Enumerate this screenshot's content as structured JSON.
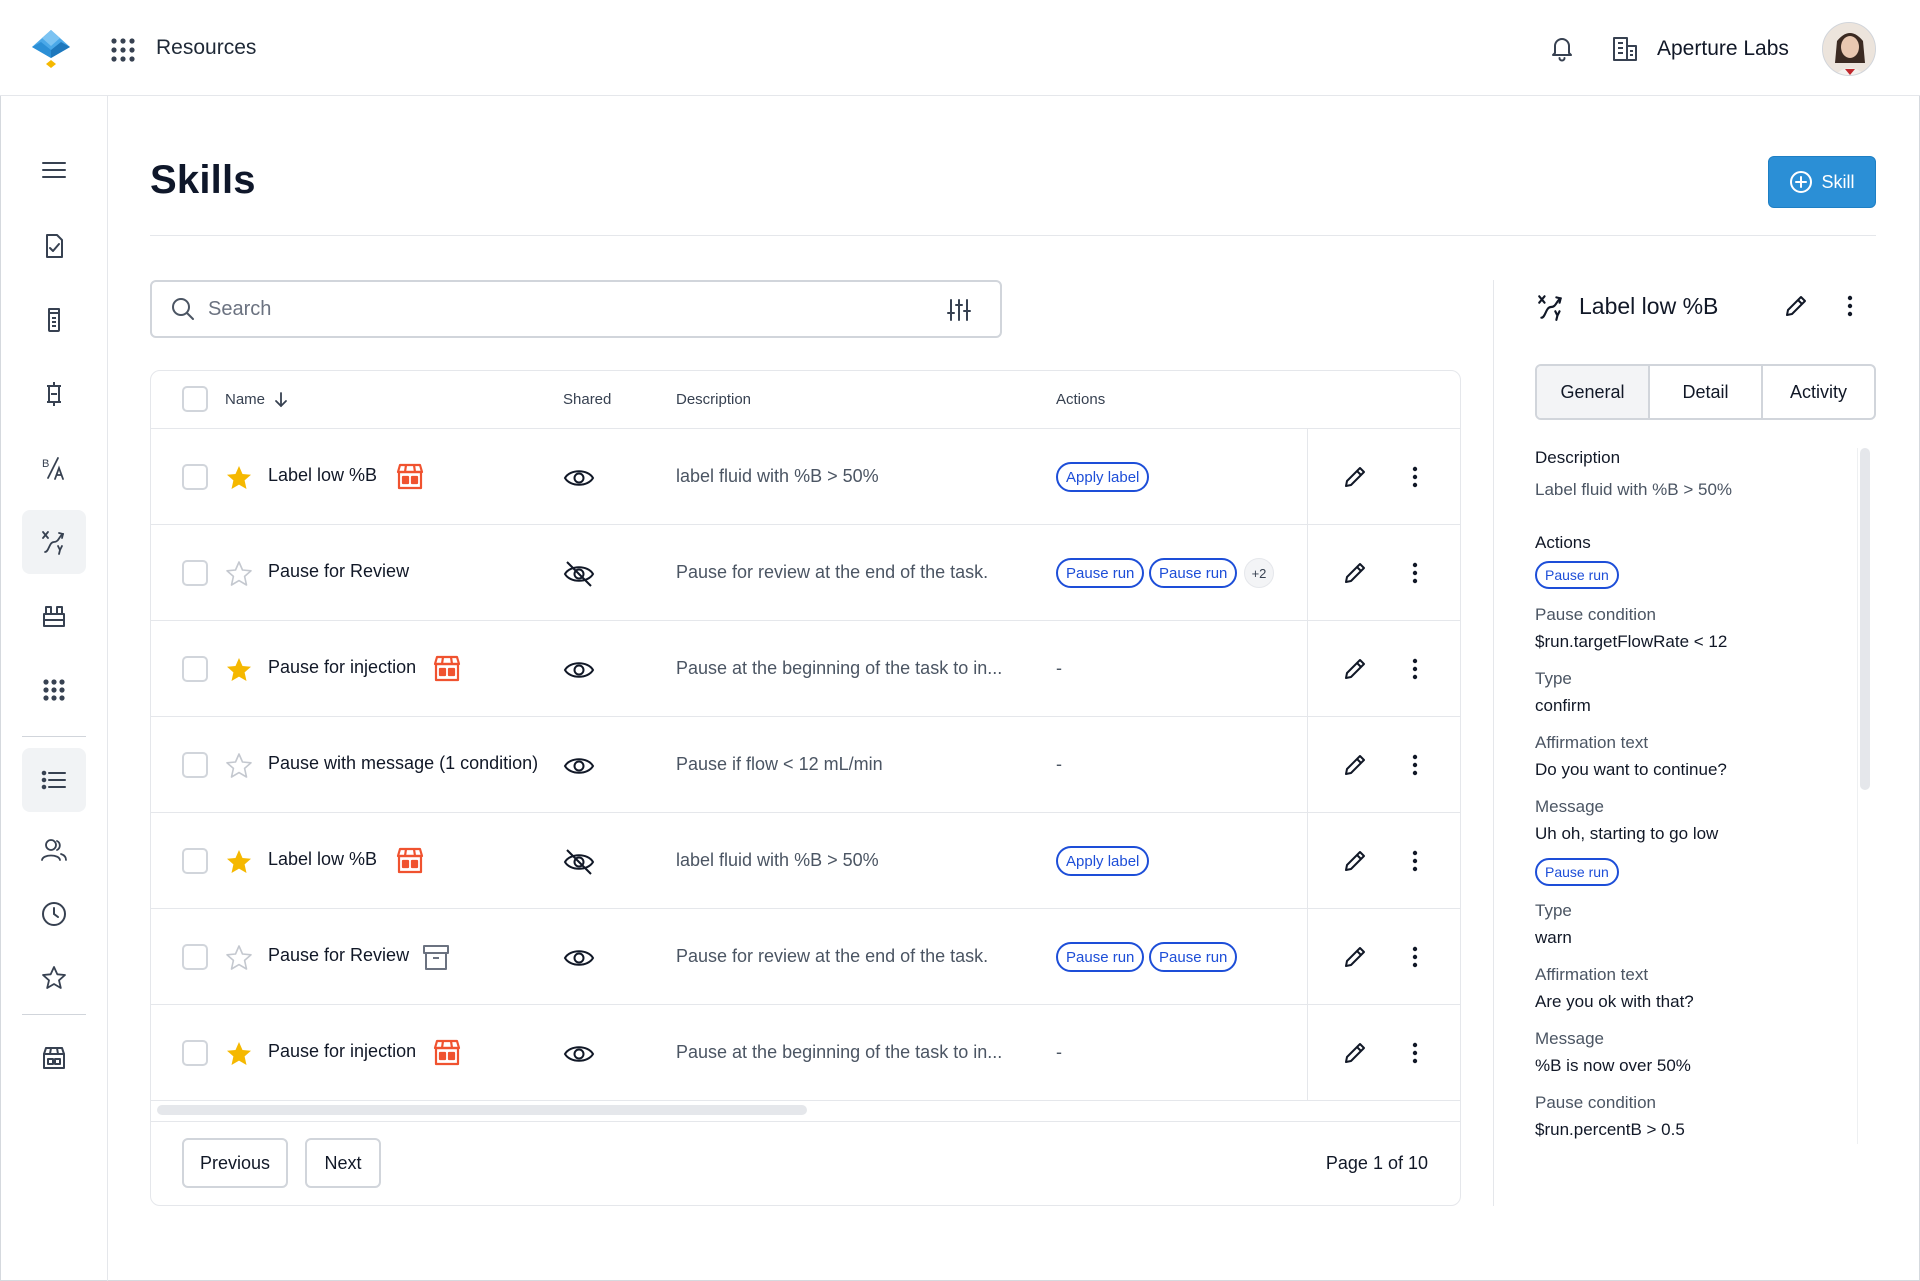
{
  "app": {
    "title": "Resources",
    "org_name": "Aperture Labs"
  },
  "colors": {
    "accent": "#2b8fd6",
    "chip": "#1d4ed8",
    "star_filled": "#f5b800",
    "badge_orange": "#f0522f"
  },
  "sidebar": {
    "items": [
      {
        "icon": "menu-icon"
      },
      {
        "icon": "clipboard-check-icon"
      },
      {
        "icon": "vial-icon"
      },
      {
        "icon": "column-icon"
      },
      {
        "icon": "formula-icon"
      },
      {
        "icon": "variable-icon",
        "active": true
      },
      {
        "icon": "rack-icon"
      },
      {
        "icon": "grid-dots-icon"
      },
      {
        "icon": "list-icon",
        "active": true
      },
      {
        "icon": "users-icon"
      },
      {
        "icon": "clock-icon"
      },
      {
        "icon": "star-icon"
      },
      {
        "icon": "store-icon"
      }
    ]
  },
  "page": {
    "title": "Skills",
    "add_button_label": "Skill"
  },
  "search": {
    "placeholder": "Search",
    "value": ""
  },
  "table": {
    "columns": {
      "name": "Name",
      "shared": "Shared",
      "description": "Description",
      "actions": "Actions"
    },
    "rows": [
      {
        "name": "Label low %B",
        "starred": true,
        "badge": "store-icon",
        "shared": true,
        "description": "label fluid with %B > 50%",
        "actions": [
          "Apply label"
        ],
        "extra": ""
      },
      {
        "name": "Pause for Review",
        "starred": false,
        "badge": "",
        "shared": false,
        "description": "Pause for review at the end of the task.",
        "actions": [
          "Pause run",
          "Pause run"
        ],
        "extra": "+2"
      },
      {
        "name": "Pause for injection",
        "starred": true,
        "badge": "store-icon",
        "shared": true,
        "description": "Pause at the beginning of the task to in...",
        "actions": [],
        "extra": "",
        "empty_action": "-"
      },
      {
        "name": "Pause with message (1 condition)",
        "starred": false,
        "badge": "",
        "shared": true,
        "description": "Pause if flow < 12 mL/min",
        "actions": [],
        "extra": "",
        "empty_action": "-"
      },
      {
        "name": "Label low %B",
        "starred": true,
        "badge": "store-icon",
        "shared": false,
        "description": "label fluid with %B > 50%",
        "actions": [
          "Apply label"
        ],
        "extra": ""
      },
      {
        "name": "Pause for Review",
        "starred": false,
        "badge": "archive-icon",
        "shared": true,
        "description": "Pause for review at the end of the task.",
        "actions": [
          "Pause run",
          "Pause run"
        ],
        "extra": ""
      },
      {
        "name": "Pause for injection",
        "starred": true,
        "badge": "store-icon",
        "shared": true,
        "description": "Pause at the beginning of the task to in...",
        "actions": [],
        "extra": "",
        "empty_action": "-"
      }
    ]
  },
  "pagination": {
    "previous": "Previous",
    "next": "Next",
    "info": "Page 1 of 10"
  },
  "panel": {
    "title": "Label low %B",
    "tabs": [
      "General",
      "Detail",
      "Activity"
    ],
    "active_tab": "General",
    "description_heading": "Description",
    "description_value": "Label fluid with %B > 50%",
    "actions_heading": "Actions",
    "action1": {
      "chip": "Pause run",
      "condition_label": "Pause condition",
      "condition_value": "$run.targetFlowRate < 12",
      "type_label": "Type",
      "type_value": "confirm",
      "affirm_label": "Affirmation text",
      "affirm_value": "Do you want to continue?",
      "message_label": "Message",
      "message_value": "Uh oh, starting to go low"
    },
    "action2": {
      "chip": "Pause run",
      "type_label": "Type",
      "type_value": "warn",
      "affirm_label": "Affirmation text",
      "affirm_value": "Are you ok with that?",
      "message_label": "Message",
      "message_value": "%B is now over 50%",
      "condition_label": "Pause condition",
      "condition_value": "$run.percentB > 0.5"
    }
  }
}
